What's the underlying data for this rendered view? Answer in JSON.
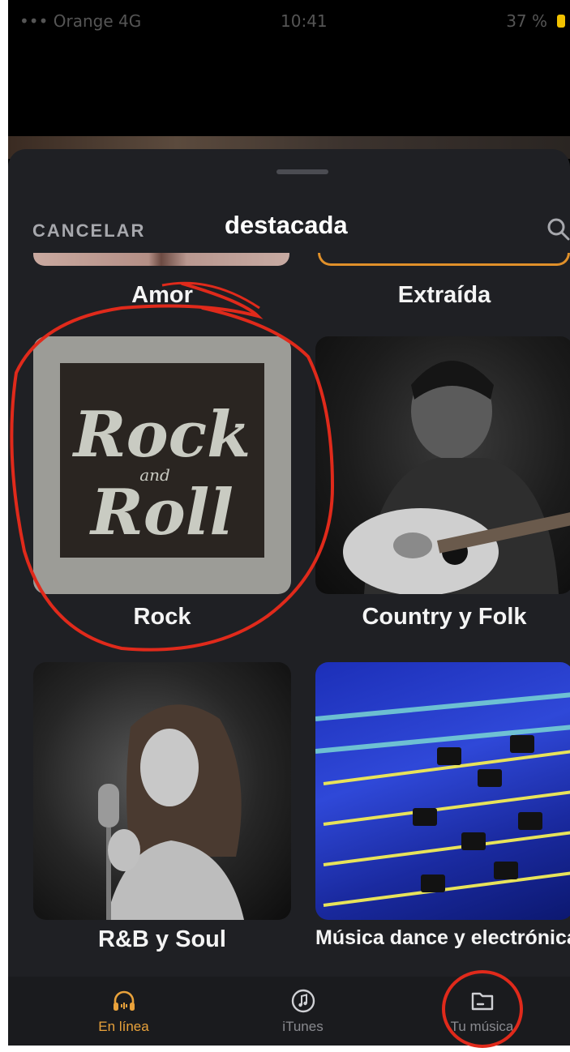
{
  "status_bar": {
    "carrier": "••• Orange  4G",
    "time": "10:41",
    "battery": "37 %"
  },
  "header": {
    "cancel_label": "CANCELAR",
    "title": "destacada",
    "search_icon": "search-icon"
  },
  "partial_row": {
    "left_label": "Amor",
    "right_label": "Extraída"
  },
  "genres": [
    {
      "label": "Rock",
      "art_text": [
        "Rock",
        "and",
        "Roll"
      ]
    },
    {
      "label": "Country y Folk"
    },
    {
      "label": "R&B y Soul"
    },
    {
      "label": "Música dance y electrónica"
    }
  ],
  "tabs": [
    {
      "label": "En línea",
      "icon": "headphones-icon",
      "active": true
    },
    {
      "label": "iTunes",
      "icon": "music-note-icon",
      "active": false
    },
    {
      "label": "Tu música",
      "icon": "folder-icon",
      "active": false
    }
  ],
  "colors": {
    "accent": "#e9a23b",
    "sheet_bg": "#1f2024",
    "tabbar_bg": "#1a1b1e",
    "annotation_red": "#e02a1b"
  }
}
